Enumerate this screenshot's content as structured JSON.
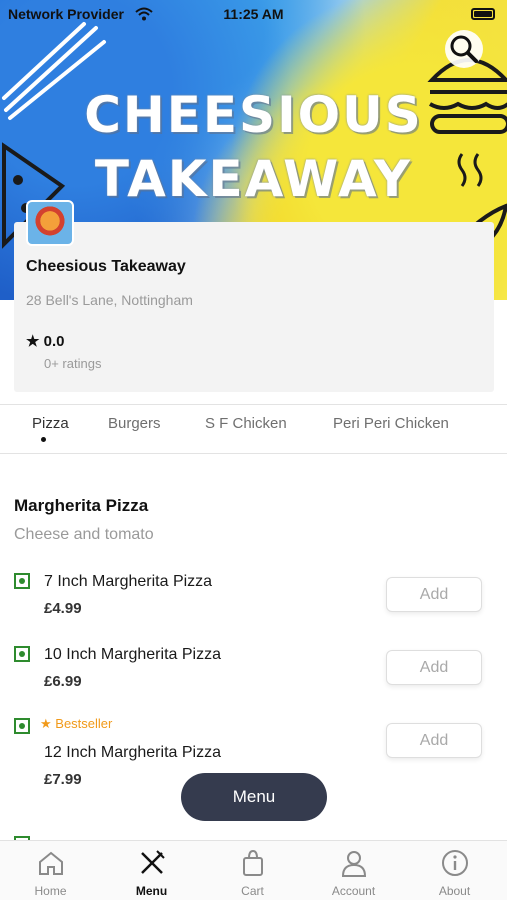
{
  "status_bar": {
    "carrier": "Network Provider",
    "time": "11:25 AM"
  },
  "banner": {
    "title_line1": "CHEESIOUS",
    "title_line2": "TAKEAWAY"
  },
  "restaurant": {
    "name": "Cheesious Takeaway",
    "address": "28 Bell's Lane, Nottingham",
    "rating": "0.0",
    "ratings_count": "0+ ratings"
  },
  "tabs": [
    {
      "label": "Pizza",
      "active": true
    },
    {
      "label": "Burgers",
      "active": false
    },
    {
      "label": "S F Chicken",
      "active": false
    },
    {
      "label": "Peri Peri Chicken",
      "active": false
    }
  ],
  "section": {
    "title": "Margherita Pizza",
    "description": "Cheese and tomato",
    "items": [
      {
        "name": "7 Inch Margherita Pizza",
        "price": "£4.99",
        "add_label": "Add",
        "badge": ""
      },
      {
        "name": "10 Inch Margherita Pizza",
        "price": "£6.99",
        "add_label": "Add",
        "badge": ""
      },
      {
        "name": "12 Inch Margherita Pizza",
        "price": "£7.99",
        "add_label": "Add",
        "badge": "Bestseller"
      }
    ]
  },
  "menu_button": {
    "label": "Menu"
  },
  "bottom_nav": [
    {
      "label": "Home",
      "icon": "home-icon",
      "active": false
    },
    {
      "label": "Menu",
      "icon": "fork-knife-icon",
      "active": true
    },
    {
      "label": "Cart",
      "icon": "shopping-bag-icon",
      "active": false
    },
    {
      "label": "Account",
      "icon": "user-icon",
      "active": false
    },
    {
      "label": "About",
      "icon": "info-icon",
      "active": false
    }
  ],
  "colors": {
    "veg_green": "#2e8b2e",
    "bestseller_orange": "#f19a1a",
    "menu_button_bg": "#353b4e",
    "nav_indicator": "#d62020"
  }
}
